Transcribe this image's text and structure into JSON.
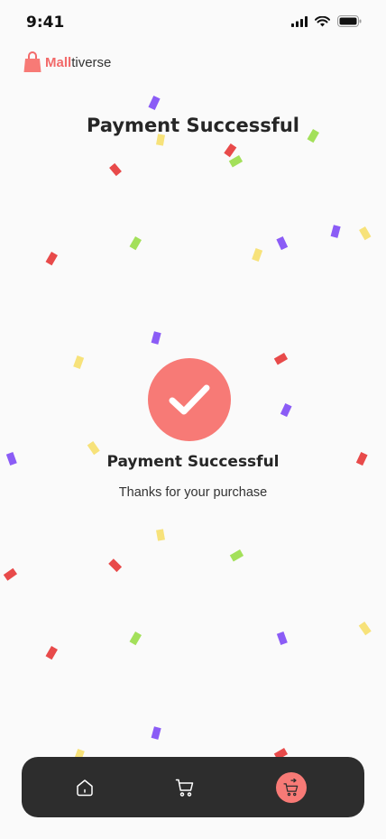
{
  "status_bar": {
    "time": "9:41"
  },
  "brand": {
    "accent": "Mall",
    "rest": "tiverse"
  },
  "page": {
    "title": "Payment Successful"
  },
  "success": {
    "heading": "Payment Successful",
    "message": "Thanks for your purchase"
  },
  "colors": {
    "accent": "#f77a76",
    "nav_background": "#2d2d2d",
    "confetti": [
      "#8b5cf6",
      "#e84a4a",
      "#a3e05a",
      "#f7e27a"
    ]
  },
  "nav": {
    "items": [
      {
        "icon": "home-icon"
      },
      {
        "icon": "cart-icon"
      },
      {
        "icon": "checkout-cart-icon",
        "active": true
      }
    ]
  }
}
